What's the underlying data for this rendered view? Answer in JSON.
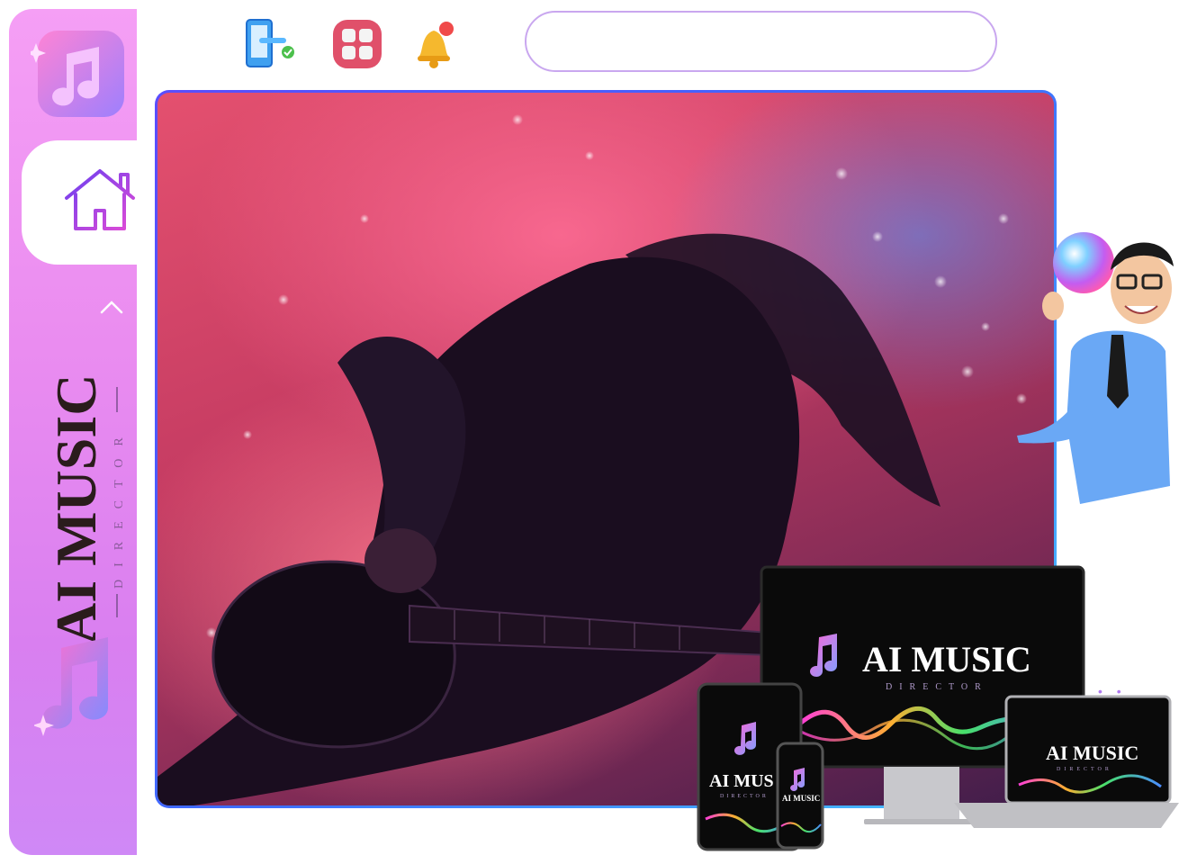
{
  "app": {
    "brand_title": "AI MUSIC",
    "brand_subtitle": "DIRECTOR"
  },
  "toolbar": {
    "icons": [
      "mobile-check-icon",
      "apps-grid-icon",
      "notification-bell-icon"
    ]
  },
  "search": {
    "value": "",
    "placeholder": ""
  },
  "sidebar": {
    "items": [
      {
        "icon": "home-icon"
      }
    ]
  },
  "hero": {
    "image": "guitarist-concert-photo"
  },
  "devices": {
    "monitor_title": "AI MUSIC",
    "monitor_subtitle": "DIRECTOR",
    "laptop_title": "AI MUSIC",
    "laptop_subtitle": "DIRECTOR",
    "tablet_title": "AI MUS",
    "tablet_subtitle": "DIRECTOR",
    "phone_title": "AI MUSIC"
  },
  "colors": {
    "sidebar_gradient_top": "#f59ff5",
    "sidebar_gradient_bottom": "#cf88f6",
    "accent_purple": "#7b3fe4",
    "hero_border": "#3d6bff"
  }
}
